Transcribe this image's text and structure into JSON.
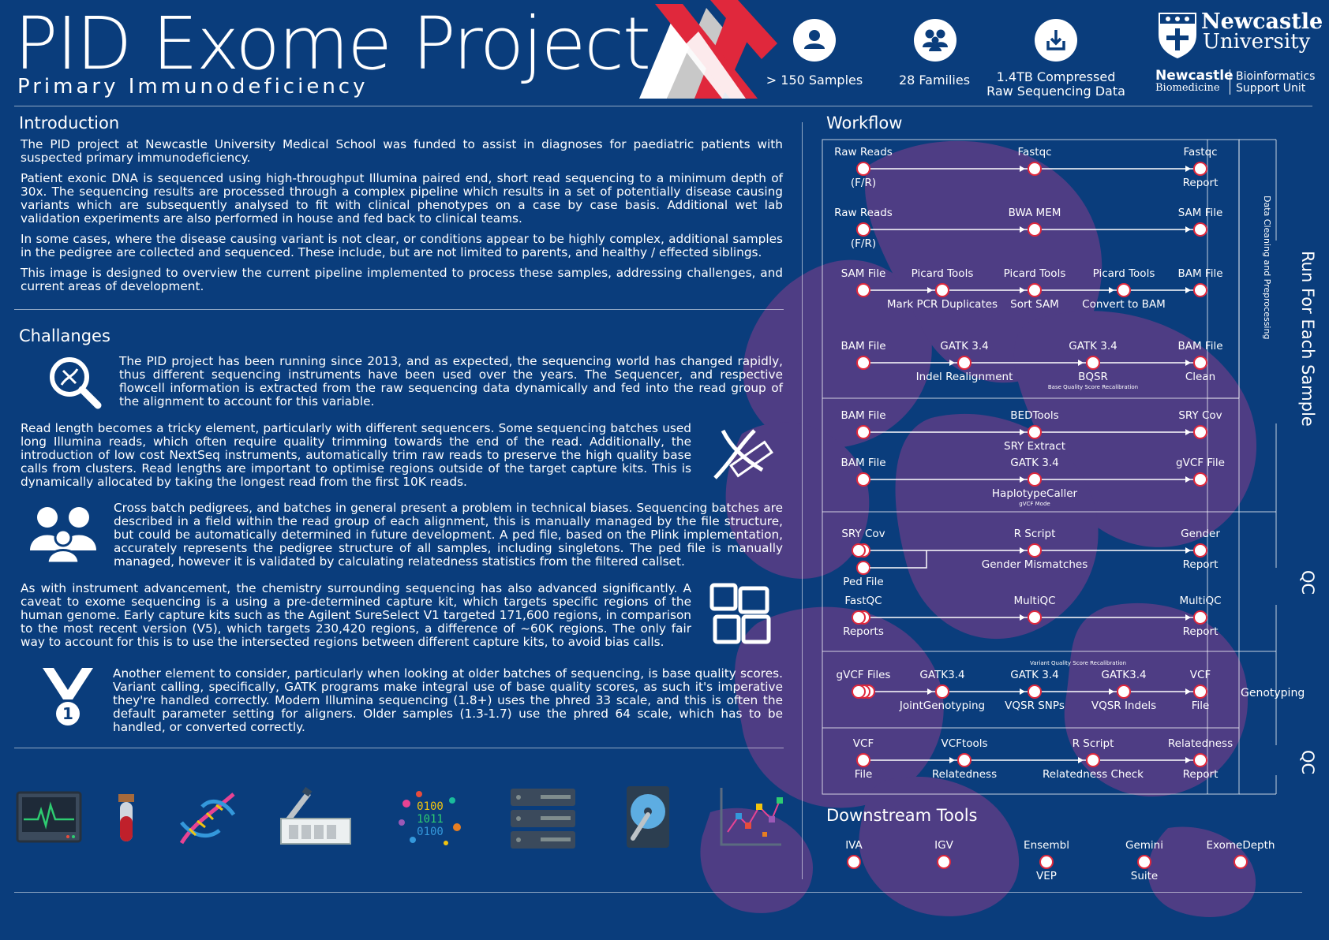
{
  "header": {
    "title": "PID Exome Project",
    "subtitle": "Primary Immunodeficiency",
    "stats": [
      {
        "label": "> 150 Samples",
        "icon": "person-icon"
      },
      {
        "label": "28 Families",
        "icon": "family-icon"
      },
      {
        "label_line1": "1.4TB Compressed",
        "label_line2": "Raw Sequencing Data",
        "icon": "download-icon"
      }
    ],
    "brand": {
      "newcastle": "Newcastle",
      "university": "University",
      "biomedicine_top": "Newcastle",
      "biomedicine_bottom": "Biomedicine",
      "bsu_top": "Bioinformatics",
      "bsu_bottom": "Support Unit"
    }
  },
  "colors": {
    "background": "#0a3d7c",
    "accent_red": "#e0283c",
    "accent_grey": "#c8c8c8",
    "lion_purple": "#5a3d86"
  },
  "introduction": {
    "heading": "Introduction",
    "paragraphs": [
      "The PID project at Newcastle University Medical School was funded to assist in diagnoses for paediatric patients with suspected primary immunodeficiency.",
      "Patient exonic DNA is sequenced using high-throughput Illumina paired end, short read sequencing to a minimum depth of 30x. The sequencing results are processed through a complex pipeline which results in a set of potentially disease causing variants which are subsequently analysed to fit with clinical phenotypes on a case by case basis. Additional wet lab validation experiments are also performed in house and fed back to clinical teams.",
      "In some cases, where the disease causing variant is not clear, or conditions appear to be highly complex, additional samples in the pedigree are collected and sequenced. These include, but are not limited to parents, and healthy / effected siblings.",
      "This image is designed to overview the current pipeline implemented to process these samples, addressing challenges, and current areas of development."
    ]
  },
  "challenges": {
    "heading": "Challanges",
    "items": [
      "The PID project has been running since 2013, and as expected, the sequencing world has changed rapidly, thus different sequencing instruments have been used over the years. The Sequencer, and respective flowcell information is extracted from the raw sequencing data dynamically and fed into the read group of the alignment to account for this variable.",
      "Read length becomes a tricky element, particularly with different sequencers. Some sequencing batches used long Illumina reads, which often require quality trimming towards the end of the read. Additionally, the introduction of low cost NextSeq instruments, automatically trim raw reads to preserve the high quality base calls from clusters. Read lengths are important to optimise regions outside of the target capture kits. This is dynamically allocated by taking the longest read from the first 10K reads.",
      "Cross batch pedigrees, and batches in general present a problem in technical biases. Sequencing batches are described in a field within the read group of each alignment, this is manually managed by the file structure, but could be automatically determined in future development. A ped file, based on the Plink implementation, accurately represents the pedigree structure of all samples, including singletons. The ped file is manually managed, however it is validated by calculating relatedness statistics from the filtered callset.",
      "As with instrument advancement, the chemistry surrounding sequencing has also advanced significantly. A caveat to exome sequencing is a using a pre-determined capture kit, which targets specific regions of the human genome. Early capture kits such as the Agilent SureSelect V1 targeted 171,600 regions, in comparison to the most recent version (V5), which targets 230,420 regions, a difference of ~60K regions. The only fair way to account for this is to use the intersected regions between different capture kits, to avoid bias calls.",
      "Another element to consider, particularly when looking at older batches of sequencing, is base quality scores. Variant calling, specifically, GATK programs make integral use of base quality scores, as such it's imperative they're handled correctly. Modern Illumina sequencing (1.8+) uses the phred 33 scale, and this is often the default parameter setting for aligners. Older samples (1.3-1.7) use the phred 64 scale, which has to be handled, or converted correctly."
    ]
  },
  "bottom_icons": [
    "monitor-icon",
    "blood-tube-icon",
    "dna-icon",
    "pipette-plate-icon",
    "binary-data-icon",
    "server-icon",
    "hard-drive-icon",
    "chart-icon"
  ],
  "workflow": {
    "heading": "Workflow",
    "side_labels": {
      "cleaning": "Data Cleaning and Preprocessing",
      "run_each": "Run For Each Sample",
      "qc1": "QC",
      "genotyping": "Genotyping",
      "qc2": "QC"
    },
    "rows": [
      {
        "nodes": [
          {
            "top": "Raw Reads",
            "bottom": "(F/R)"
          },
          {
            "top": "Fastqc",
            "bottom": ""
          },
          {
            "top": "Fastqc",
            "bottom": "Report"
          }
        ]
      },
      {
        "nodes": [
          {
            "top": "Raw Reads",
            "bottom": "(F/R)"
          },
          {
            "top": "BWA MEM",
            "bottom": ""
          },
          {
            "top": "SAM File",
            "bottom": ""
          }
        ]
      },
      {
        "nodes": [
          {
            "top": "SAM File",
            "bottom": ""
          },
          {
            "top": "Picard Tools",
            "bottom": "Mark PCR Duplicates"
          },
          {
            "top": "Picard Tools",
            "bottom": "Sort SAM"
          },
          {
            "top": "Picard Tools",
            "bottom": "Convert to BAM"
          },
          {
            "top": "BAM File",
            "bottom": ""
          }
        ]
      },
      {
        "nodes": [
          {
            "top": "BAM File",
            "bottom": ""
          },
          {
            "top": "GATK 3.4",
            "bottom": "Indel Realignment"
          },
          {
            "top": "GATK 3.4",
            "bottom": "BQSR",
            "tiny": "Base Quality Score Recalibration"
          },
          {
            "top": "BAM File",
            "bottom": "Clean"
          }
        ]
      },
      {
        "nodes": [
          {
            "top": "BAM File",
            "bottom": ""
          },
          {
            "top": "BEDTools",
            "bottom": "SRY Extract"
          },
          {
            "top": "SRY Cov",
            "bottom": ""
          }
        ]
      },
      {
        "nodes": [
          {
            "top": "BAM File",
            "bottom": ""
          },
          {
            "top": "GATK 3.4",
            "bottom": "HaplotypeCaller",
            "tiny": "gVCF Mode"
          },
          {
            "top": "gVCF File",
            "bottom": ""
          }
        ]
      },
      {
        "nodes": [
          {
            "top": "SRY Cov",
            "bottom": ""
          },
          {
            "top": "R Script",
            "bottom": "Gender Mismatches"
          },
          {
            "top": "Gender",
            "bottom": "Report"
          }
        ],
        "extra": "Ped File"
      },
      {
        "nodes": [
          {
            "top": "FastQC",
            "bottom": "Reports"
          },
          {
            "top": "MultiQC",
            "bottom": ""
          },
          {
            "top": "MultiQC",
            "bottom": "Report"
          }
        ]
      },
      {
        "nodes": [
          {
            "top": "gVCF Files",
            "bottom": ""
          },
          {
            "top": "GATK3.4",
            "bottom": "JointGenotyping"
          },
          {
            "top": "GATK 3.4",
            "bottom": "VQSR SNPs",
            "tiny_top": "Variant Quality Score Recalibration"
          },
          {
            "top": "GATK3.4",
            "bottom": "VQSR Indels"
          },
          {
            "top": "VCF",
            "bottom": "File"
          }
        ]
      },
      {
        "nodes": [
          {
            "top": "VCF",
            "bottom": "File"
          },
          {
            "top": "VCFtools",
            "bottom": "Relatedness"
          },
          {
            "top": "R Script",
            "bottom": "Relatedness Check"
          },
          {
            "top": "Relatedness",
            "bottom": "Report"
          }
        ]
      }
    ]
  },
  "downstream": {
    "heading": "Downstream Tools",
    "tools": [
      {
        "top": "IVA",
        "bottom": ""
      },
      {
        "top": "IGV",
        "bottom": ""
      },
      {
        "top": "Ensembl",
        "bottom": "VEP"
      },
      {
        "top": "Gemini",
        "bottom": "Suite"
      },
      {
        "top": "ExomeDepth",
        "bottom": ""
      }
    ]
  }
}
